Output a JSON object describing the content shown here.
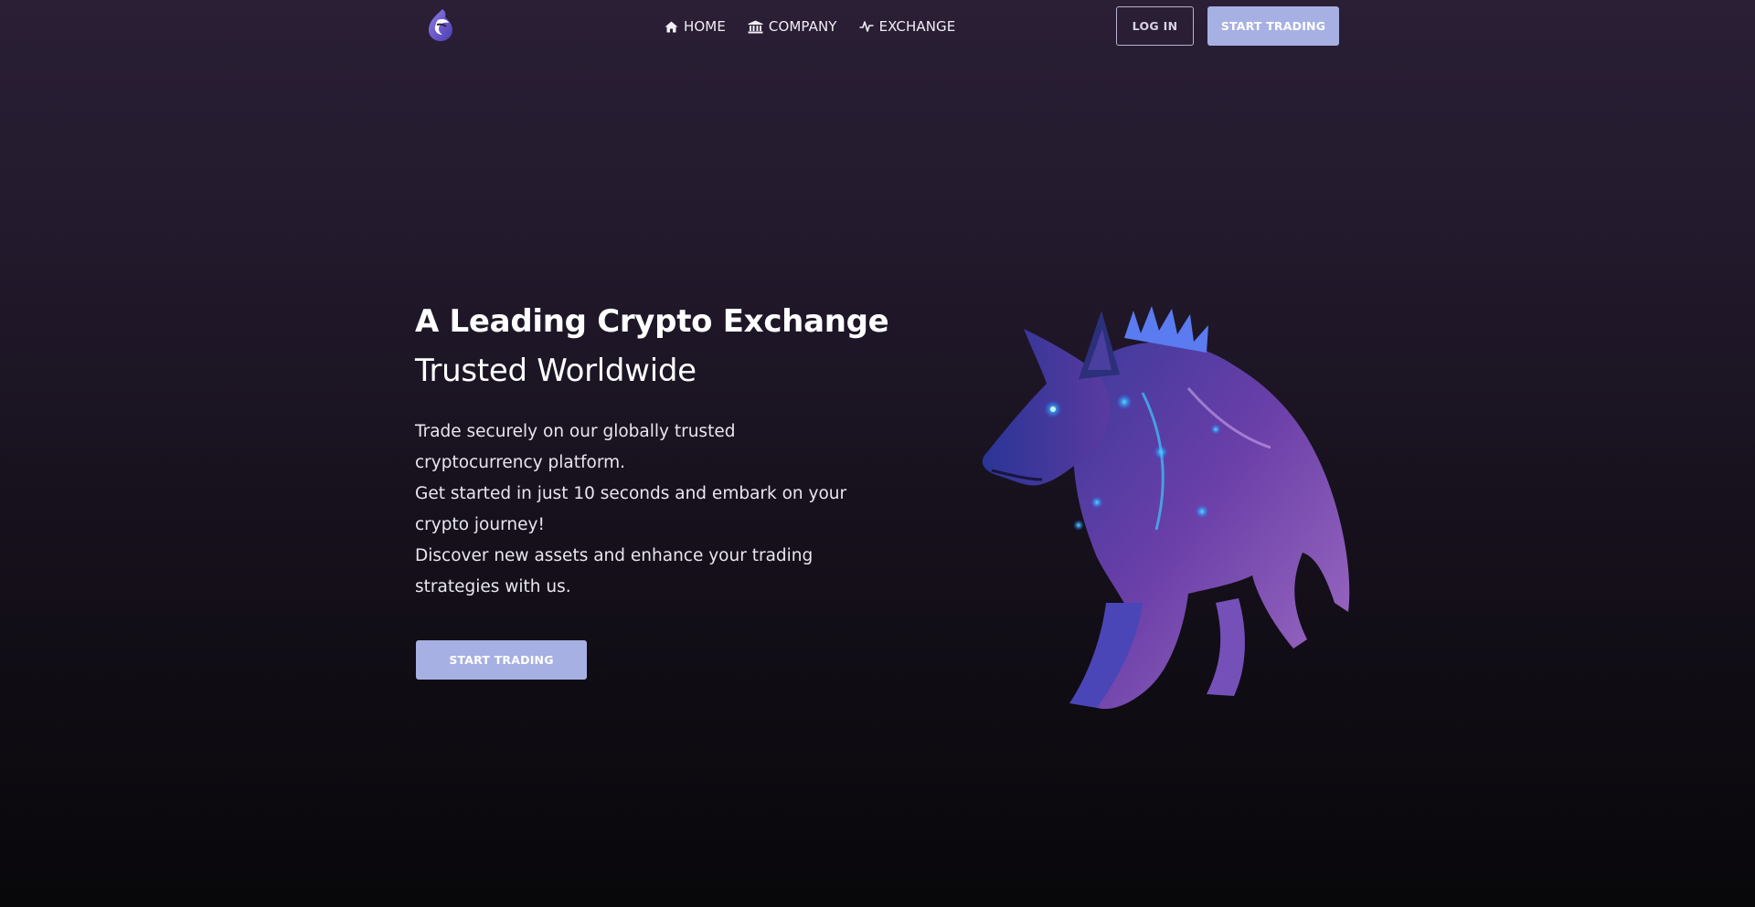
{
  "header": {
    "logo_icon": "flame-drop-logo",
    "nav": [
      {
        "icon": "home-icon",
        "label": "HOME"
      },
      {
        "icon": "bank-icon",
        "label": "COMPANY"
      },
      {
        "icon": "pulse-icon",
        "label": "EXCHANGE"
      }
    ],
    "login_label": "LOG IN",
    "start_trading_label": "START TRADING"
  },
  "hero": {
    "title": "A Leading Crypto Exchange",
    "subtitle": "Trusted Worldwide",
    "description": [
      "Trade securely on our globally trusted cryptocurrency platform.",
      "Get started in just 10 seconds and embark on your crypto journey!",
      "Discover new assets and enhance your trading strategies with us."
    ],
    "cta_label": "START TRADING",
    "illustration": "cyber-wolf-image"
  },
  "colors": {
    "accent_button": "#a7b0e3",
    "background_top": "#2a1f35",
    "background_bottom": "#08070a",
    "text": "#ffffff"
  }
}
